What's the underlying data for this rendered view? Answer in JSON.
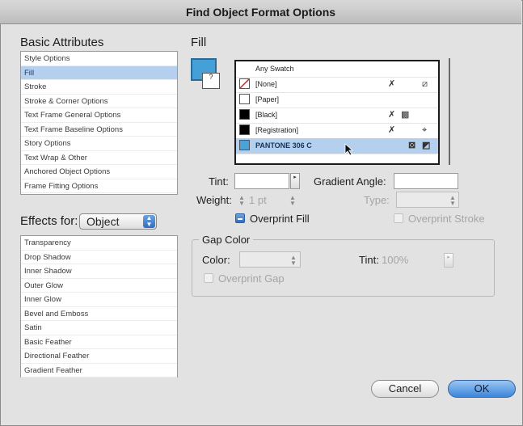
{
  "window": {
    "title": "Find Object Format Options"
  },
  "basic_attributes": {
    "heading": "Basic Attributes",
    "items": [
      {
        "label": "Style Options",
        "selected": false
      },
      {
        "label": "Fill",
        "selected": true
      },
      {
        "label": "Stroke",
        "selected": false
      },
      {
        "label": "Stroke & Corner Options",
        "selected": false
      },
      {
        "label": "Text Frame General Options",
        "selected": false
      },
      {
        "label": "Text Frame Baseline Options",
        "selected": false
      },
      {
        "label": "Story Options",
        "selected": false
      },
      {
        "label": "Text Wrap & Other",
        "selected": false
      },
      {
        "label": "Anchored Object Options",
        "selected": false
      },
      {
        "label": "Frame Fitting Options",
        "selected": false
      }
    ]
  },
  "effects": {
    "label": "Effects for:",
    "selected_value": "Object",
    "items": [
      "Transparency",
      "Drop Shadow",
      "Inner Shadow",
      "Outer Glow",
      "Inner Glow",
      "Bevel and Emboss",
      "Satin",
      "Basic Feather",
      "Directional Feather",
      "Gradient Feather"
    ]
  },
  "fill": {
    "heading": "Fill",
    "proxy_color": "#46a0d8",
    "swatches": [
      {
        "name": "Any Swatch",
        "chip": "none"
      },
      {
        "name": "[None]",
        "chip": "none-slash"
      },
      {
        "name": "[Paper]",
        "chip": "#ffffff"
      },
      {
        "name": "[Black]",
        "chip": "#000000"
      },
      {
        "name": "[Registration]",
        "chip": "#000000"
      },
      {
        "name": "PANTONE 306 C",
        "chip": "#4aa3d6",
        "selected": true
      }
    ],
    "tint_label": "Tint:",
    "tint_value": "",
    "gradient_angle_label": "Gradient Angle:",
    "gradient_angle_value": "",
    "weight_label": "Weight:",
    "weight_value": "1 pt",
    "type_label": "Type:",
    "type_value": "",
    "overprint_fill_label": "Overprint Fill",
    "overprint_fill_checked": true,
    "overprint_stroke_label": "Overprint Stroke",
    "overprint_stroke_checked": false
  },
  "gap_color": {
    "heading": "Gap Color",
    "color_label": "Color:",
    "color_value": "",
    "tint_label": "Tint:",
    "tint_value": "100%",
    "overprint_gap_label": "Overprint Gap"
  },
  "buttons": {
    "cancel": "Cancel",
    "ok": "OK"
  },
  "colors": {
    "selection": "#b5d0ee",
    "accent": "#3b86dc"
  }
}
